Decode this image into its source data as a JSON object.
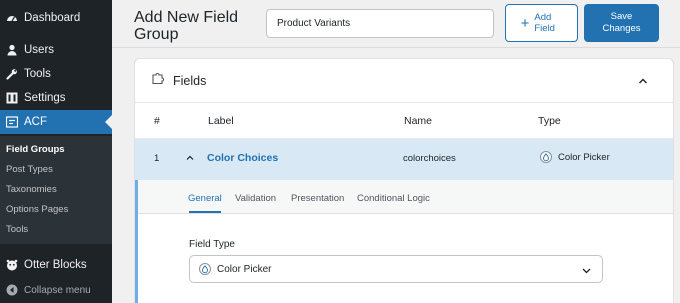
{
  "sidebar": {
    "items": [
      {
        "label": "Dashboard",
        "icon": "dashboard-icon"
      },
      {
        "label": "Users",
        "icon": "users-icon"
      },
      {
        "label": "Tools",
        "icon": "tools-icon"
      },
      {
        "label": "Settings",
        "icon": "settings-icon"
      },
      {
        "label": "ACF",
        "icon": "acf-icon"
      }
    ],
    "submenu": [
      "Field Groups",
      "Post Types",
      "Taxonomies",
      "Options Pages",
      "Tools"
    ],
    "otter": "Otter Blocks",
    "collapse": "Collapse menu",
    "accent": "#2271b1"
  },
  "header": {
    "title": "Add New Field Group",
    "group_title_value": "Product Variants",
    "add_field": "Add Field",
    "add_field_plus": "+",
    "save": "Save Changes"
  },
  "panel": {
    "title": "Fields",
    "columns": [
      "#",
      "Label",
      "Name",
      "Type"
    ],
    "field": {
      "number": "1",
      "label": "Color Choices",
      "name": "colorchoices",
      "type": "Color Picker"
    },
    "tabs": [
      "General",
      "Validation",
      "Presentation",
      "Conditional Logic"
    ],
    "field_type_label": "Field Type",
    "field_type_value": "Color Picker"
  }
}
